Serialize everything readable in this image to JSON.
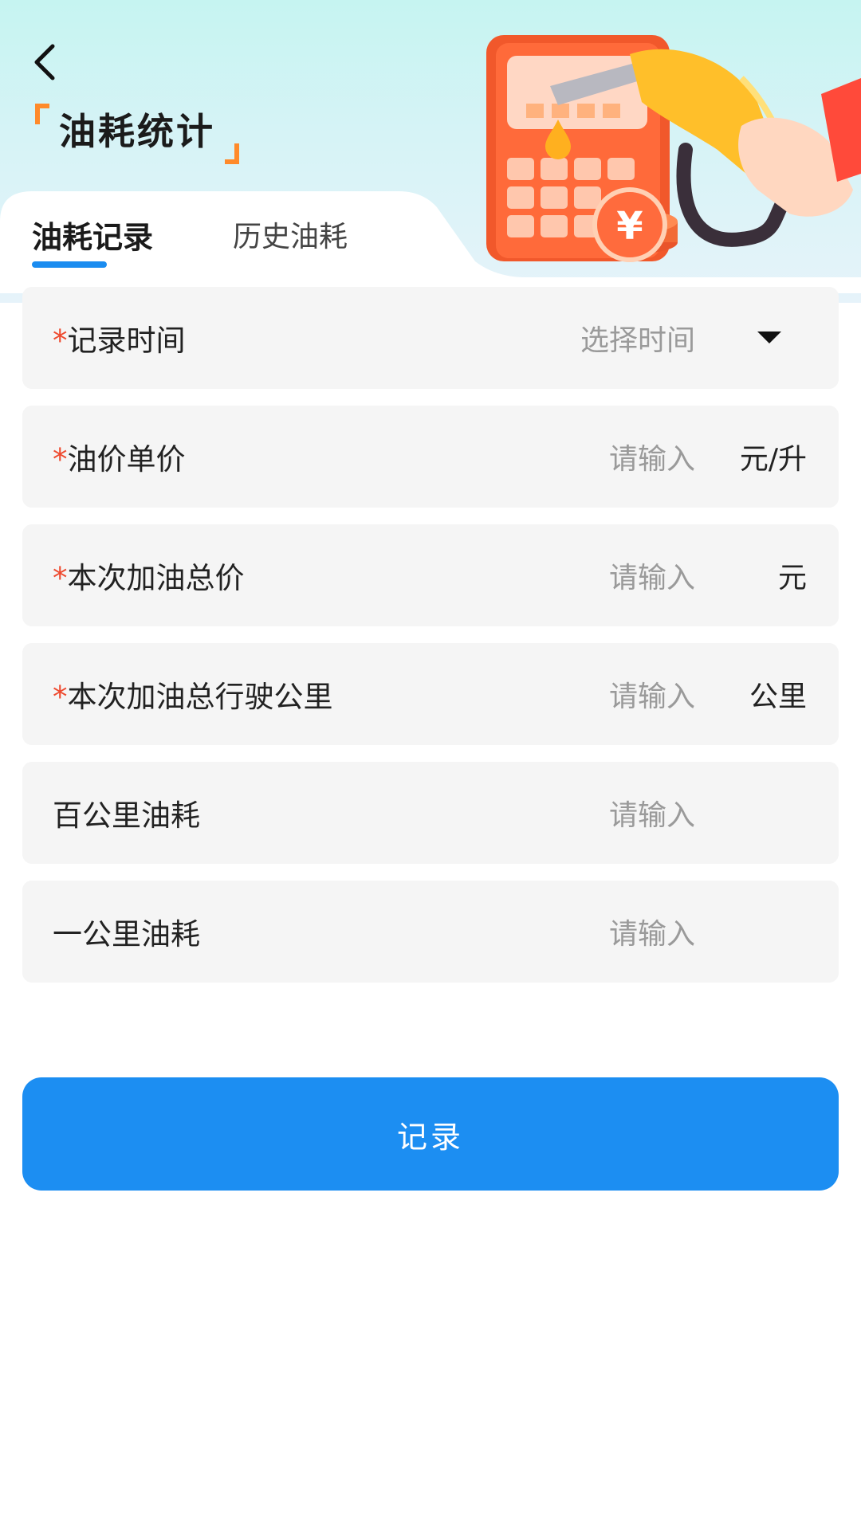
{
  "header": {
    "title": "油耗统计",
    "back_icon": "chevron-left-icon",
    "illustration": "fuel-nozzle-calculator-illustration"
  },
  "tabs": [
    {
      "label": "油耗记录",
      "active": true
    },
    {
      "label": "历史油耗",
      "active": false
    }
  ],
  "form": {
    "rows": [
      {
        "required": "*",
        "label": "记录时间",
        "placeholder": "选择时间",
        "unit": "",
        "type": "select"
      },
      {
        "required": "*",
        "label": "油价单价",
        "placeholder": "请输入",
        "unit": "元/升",
        "type": "input"
      },
      {
        "required": "*",
        "label": "本次加油总价",
        "placeholder": "请输入",
        "unit": "元",
        "type": "input"
      },
      {
        "required": "*",
        "label": "本次加油总行驶公里",
        "placeholder": "请输入",
        "unit": "公里",
        "type": "input"
      },
      {
        "required": "",
        "label": "百公里油耗",
        "placeholder": "请输入",
        "unit": "",
        "type": "input"
      },
      {
        "required": "",
        "label": "一公里油耗",
        "placeholder": "请输入",
        "unit": "",
        "type": "input"
      }
    ]
  },
  "submit": {
    "label": "记录"
  },
  "colors": {
    "accent": "#1c8ef2",
    "required": "#ee4a2f",
    "title_bracket": "#ff8a2a",
    "row_bg": "#f5f5f5"
  }
}
